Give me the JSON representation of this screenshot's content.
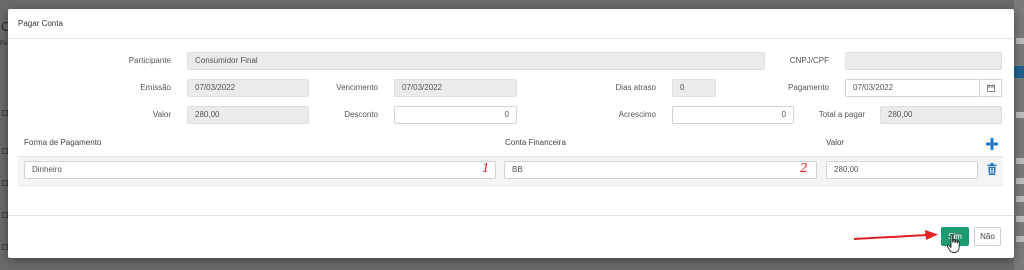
{
  "background": {
    "left_letter": "C",
    "left_sub": "Pá"
  },
  "modal": {
    "title": "Pagar Conta"
  },
  "form": {
    "participante": {
      "label": "Participante",
      "value": "Consumidor Final"
    },
    "cnpj_cpf": {
      "label": "CNPJ/CPF",
      "value": ""
    },
    "emissao": {
      "label": "Emissão",
      "value": "07/03/2022"
    },
    "vencimento": {
      "label": "Vencimento",
      "value": "07/03/2022"
    },
    "dias_atraso": {
      "label": "Dias atraso",
      "value": "0"
    },
    "pagamento": {
      "label": "Pagamento",
      "value": "07/03/2022"
    },
    "valor": {
      "label": "Valor",
      "value": "280,00"
    },
    "desconto": {
      "label": "Desconto",
      "value": "0"
    },
    "acrescimo": {
      "label": "Acrescimo",
      "value": "0"
    },
    "total_a_pagar": {
      "label": "Total a pagar",
      "value": "280,00"
    }
  },
  "payments": {
    "headers": {
      "forma": "Forma de Pagamento",
      "conta": "Conta Financeira",
      "valor": "Valor"
    },
    "rows": [
      {
        "forma": "Dinheiro",
        "conta": "BB",
        "valor": "280,00"
      }
    ],
    "annotations": [
      "1",
      "2"
    ]
  },
  "footer": {
    "sim_label": "Sim",
    "nao_label": "Não"
  },
  "colors": {
    "primary_green": "#1e9a73",
    "plus_blue": "#2a7ac0",
    "annotation_red": "#e02020"
  },
  "icons": {
    "calendar": "calendar-icon",
    "add": "plus-icon",
    "delete": "trash-icon"
  }
}
